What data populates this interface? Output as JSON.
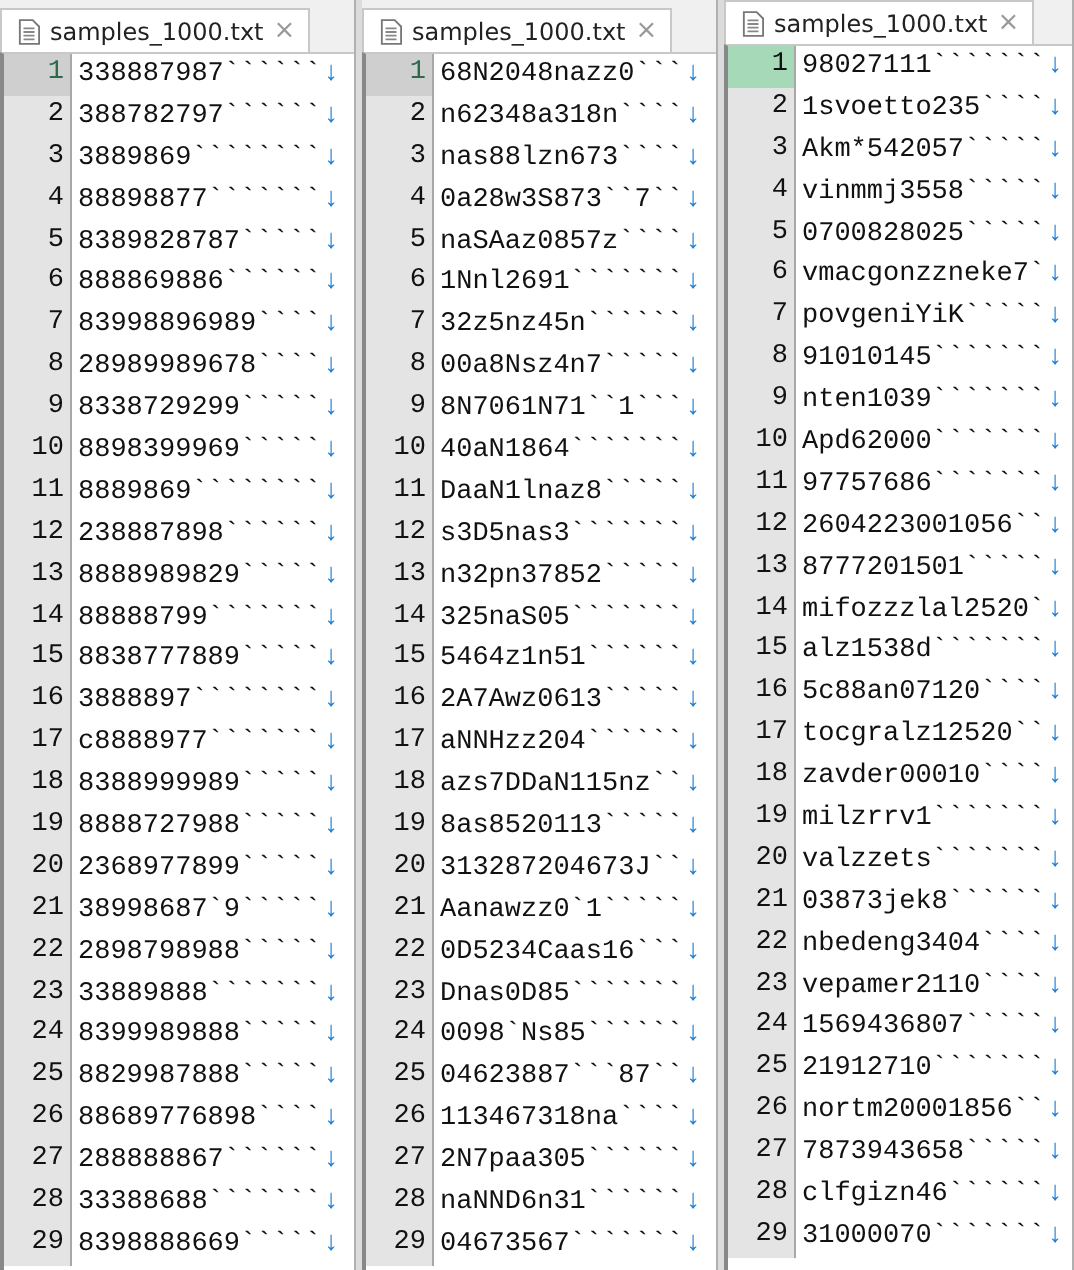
{
  "panes": [
    {
      "tab": {
        "title": "samples_1000.txt",
        "close": "×"
      },
      "focused": false,
      "lines": [
        {
          "number": "1",
          "text": "338887987``````",
          "eol": "↓",
          "current": true
        },
        {
          "number": "2",
          "text": "388782797``````",
          "eol": "↓",
          "current": false
        },
        {
          "number": "3",
          "text": "3889869````````",
          "eol": "↓",
          "current": false
        },
        {
          "number": "4",
          "text": "88898877```````",
          "eol": "↓",
          "current": false
        },
        {
          "number": "5",
          "text": "8389828787`````",
          "eol": "↓",
          "current": false
        },
        {
          "number": "6",
          "text": "888869886``````",
          "eol": "↓",
          "current": false
        },
        {
          "number": "7",
          "text": "83998896989````",
          "eol": "↓",
          "current": false
        },
        {
          "number": "8",
          "text": "28989989678````",
          "eol": "↓",
          "current": false
        },
        {
          "number": "9",
          "text": "8338729299`````",
          "eol": "↓",
          "current": false
        },
        {
          "number": "10",
          "text": "8898399969`````",
          "eol": "↓",
          "current": false
        },
        {
          "number": "11",
          "text": "8889869````````",
          "eol": "↓",
          "current": false
        },
        {
          "number": "12",
          "text": "238887898``````",
          "eol": "↓",
          "current": false
        },
        {
          "number": "13",
          "text": "8888989829`````",
          "eol": "↓",
          "current": false
        },
        {
          "number": "14",
          "text": "88888799```````",
          "eol": "↓",
          "current": false
        },
        {
          "number": "15",
          "text": "8838777889`````",
          "eol": "↓",
          "current": false
        },
        {
          "number": "16",
          "text": "3888897````````",
          "eol": "↓",
          "current": false
        },
        {
          "number": "17",
          "text": "c8888977```````",
          "eol": "↓",
          "current": false
        },
        {
          "number": "18",
          "text": "8388999989`````",
          "eol": "↓",
          "current": false
        },
        {
          "number": "19",
          "text": "8888727988`````",
          "eol": "↓",
          "current": false
        },
        {
          "number": "20",
          "text": "2368977899`````",
          "eol": "↓",
          "current": false
        },
        {
          "number": "21",
          "text": "38998687`9`````",
          "eol": "↓",
          "current": false
        },
        {
          "number": "22",
          "text": "2898798988`````",
          "eol": "↓",
          "current": false
        },
        {
          "number": "23",
          "text": "33889888```````",
          "eol": "↓",
          "current": false
        },
        {
          "number": "24",
          "text": "8399989888`````",
          "eol": "↓",
          "current": false
        },
        {
          "number": "25",
          "text": "8829987888`````",
          "eol": "↓",
          "current": false
        },
        {
          "number": "26",
          "text": "88689776898````",
          "eol": "↓",
          "current": false
        },
        {
          "number": "27",
          "text": "288888867``````",
          "eol": "↓",
          "current": false
        },
        {
          "number": "28",
          "text": "33388688```````",
          "eol": "↓",
          "current": false
        },
        {
          "number": "29",
          "text": "8398888669`````",
          "eol": "↓",
          "current": false
        }
      ]
    },
    {
      "tab": {
        "title": "samples_1000.txt",
        "close": "×"
      },
      "focused": false,
      "lines": [
        {
          "number": "1",
          "text": "68N2048nazz0```",
          "eol": "↓",
          "current": true
        },
        {
          "number": "2",
          "text": "n62348a318n````",
          "eol": "↓",
          "current": false
        },
        {
          "number": "3",
          "text": "nas88lzn673````",
          "eol": "↓",
          "current": false
        },
        {
          "number": "4",
          "text": "0a28w3S873``7``",
          "eol": "↓",
          "current": false
        },
        {
          "number": "5",
          "text": "naSAaz0857z````",
          "eol": "↓",
          "current": false
        },
        {
          "number": "6",
          "text": "1Nnl2691```````",
          "eol": "↓",
          "current": false
        },
        {
          "number": "7",
          "text": "32z5nz45n``````",
          "eol": "↓",
          "current": false
        },
        {
          "number": "8",
          "text": "00a8Nsz4n7`````",
          "eol": "↓",
          "current": false
        },
        {
          "number": "9",
          "text": "8N7061N71``1```",
          "eol": "↓",
          "current": false
        },
        {
          "number": "10",
          "text": "40aN1864```````",
          "eol": "↓",
          "current": false
        },
        {
          "number": "11",
          "text": "DaaN1lnaz8`````",
          "eol": "↓",
          "current": false
        },
        {
          "number": "12",
          "text": "s3D5nas3```````",
          "eol": "↓",
          "current": false
        },
        {
          "number": "13",
          "text": "n32pn37852`````",
          "eol": "↓",
          "current": false
        },
        {
          "number": "14",
          "text": "325naS05```````",
          "eol": "↓",
          "current": false
        },
        {
          "number": "15",
          "text": "5464z1n51``````",
          "eol": "↓",
          "current": false
        },
        {
          "number": "16",
          "text": "2A7Awz0613`````",
          "eol": "↓",
          "current": false
        },
        {
          "number": "17",
          "text": "aNNHzz204``````",
          "eol": "↓",
          "current": false
        },
        {
          "number": "18",
          "text": "azs7DDaN115nz``",
          "eol": "↓",
          "current": false
        },
        {
          "number": "19",
          "text": "8as8520113`````",
          "eol": "↓",
          "current": false
        },
        {
          "number": "20",
          "text": "313287204673J``",
          "eol": "↓",
          "current": false
        },
        {
          "number": "21",
          "text": "Aanawzz0`1`````",
          "eol": "↓",
          "current": false
        },
        {
          "number": "22",
          "text": "0D5234Caas16```",
          "eol": "↓",
          "current": false
        },
        {
          "number": "23",
          "text": "Dnas0D85```````",
          "eol": "↓",
          "current": false
        },
        {
          "number": "24",
          "text": "0098`Ns85``````",
          "eol": "↓",
          "current": false
        },
        {
          "number": "25",
          "text": "04623887```87``",
          "eol": "↓",
          "current": false
        },
        {
          "number": "26",
          "text": "113467318na````",
          "eol": "↓",
          "current": false
        },
        {
          "number": "27",
          "text": "2N7paa305``````",
          "eol": "↓",
          "current": false
        },
        {
          "number": "28",
          "text": "naNND6n31``````",
          "eol": "↓",
          "current": false
        },
        {
          "number": "29",
          "text": "04673567```````",
          "eol": "↓",
          "current": false
        }
      ]
    },
    {
      "tab": {
        "title": "samples_1000.txt",
        "close": "×"
      },
      "focused": true,
      "lines": [
        {
          "number": "1",
          "text": "98027111```````",
          "eol": "↓",
          "current": true
        },
        {
          "number": "2",
          "text": "1svoetto235````",
          "eol": "↓",
          "current": false
        },
        {
          "number": "3",
          "text": "Akm*542057`````",
          "eol": "↓",
          "current": false
        },
        {
          "number": "4",
          "text": "vinmmj3558`````",
          "eol": "↓",
          "current": false
        },
        {
          "number": "5",
          "text": "0700828025`````",
          "eol": "↓",
          "current": false
        },
        {
          "number": "6",
          "text": "vmacgonzzneke7`",
          "eol": "↓",
          "current": false
        },
        {
          "number": "7",
          "text": "povgeniYiK`````",
          "eol": "↓",
          "current": false
        },
        {
          "number": "8",
          "text": "91010145```````",
          "eol": "↓",
          "current": false
        },
        {
          "number": "9",
          "text": "nten1039```````",
          "eol": "↓",
          "current": false
        },
        {
          "number": "10",
          "text": "Apd62000```````",
          "eol": "↓",
          "current": false
        },
        {
          "number": "11",
          "text": "97757686```````",
          "eol": "↓",
          "current": false
        },
        {
          "number": "12",
          "text": "2604223001056``",
          "eol": "↓",
          "current": false
        },
        {
          "number": "13",
          "text": "8777201501`````",
          "eol": "↓",
          "current": false
        },
        {
          "number": "14",
          "text": "mifozzzlal2520`",
          "eol": "↓",
          "current": false
        },
        {
          "number": "15",
          "text": "alz1538d```````",
          "eol": "↓",
          "current": false
        },
        {
          "number": "16",
          "text": "5c88an07120````",
          "eol": "↓",
          "current": false
        },
        {
          "number": "17",
          "text": "tocgralz12520``",
          "eol": "↓",
          "current": false
        },
        {
          "number": "18",
          "text": "zavder00010````",
          "eol": "↓",
          "current": false
        },
        {
          "number": "19",
          "text": "milzrrv1```````",
          "eol": "↓",
          "current": false
        },
        {
          "number": "20",
          "text": "valzzets```````",
          "eol": "↓",
          "current": false
        },
        {
          "number": "21",
          "text": "03873jek8``````",
          "eol": "↓",
          "current": false
        },
        {
          "number": "22",
          "text": "nbedeng3404````",
          "eol": "↓",
          "current": false
        },
        {
          "number": "23",
          "text": "vepamer2110````",
          "eol": "↓",
          "current": false
        },
        {
          "number": "24",
          "text": "1569436807`````",
          "eol": "↓",
          "current": false
        },
        {
          "number": "25",
          "text": "21912710```````",
          "eol": "↓",
          "current": false
        },
        {
          "number": "26",
          "text": "nortm20001856``",
          "eol": "↓",
          "current": false
        },
        {
          "number": "27",
          "text": "7873943658`````",
          "eol": "↓",
          "current": false
        },
        {
          "number": "28",
          "text": "clfgizn46``````",
          "eol": "↓",
          "current": false
        },
        {
          "number": "29",
          "text": "31000070```````",
          "eol": "↓",
          "current": false
        }
      ]
    }
  ]
}
